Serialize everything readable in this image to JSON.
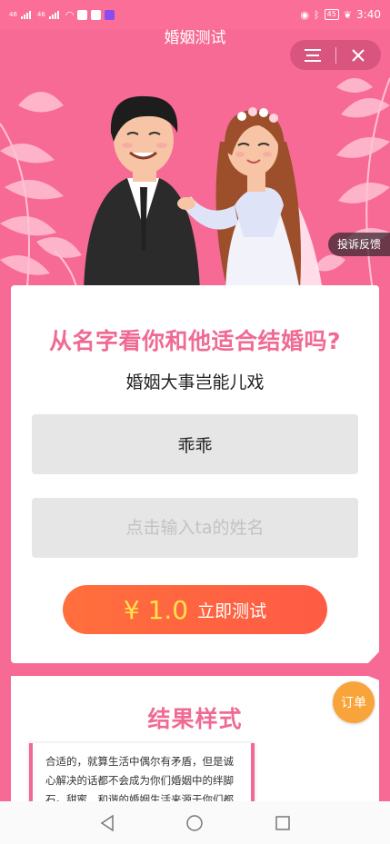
{
  "status_bar": {
    "signal1": "46",
    "signal2": "46",
    "battery": "45",
    "time": "3:40"
  },
  "header": {
    "title": "婚姻测试",
    "menu_icon": "menu-icon",
    "close_icon": "close-icon"
  },
  "hero": {
    "complaint_label": "投诉反馈"
  },
  "card": {
    "title": "从名字看你和他适合结婚吗?",
    "subtitle": "婚姻大事岂能儿戏",
    "name_value": "乖乖",
    "partner_placeholder": "点击输入ta的姓名",
    "price": "¥ 1.0",
    "button_label": "立即测试"
  },
  "result": {
    "title": "结果样式",
    "sample_text": "合适的，就算生活中偶尔有矛盾，但是诚心解决的话都不会成为你们婚姻中的绊脚石。甜蜜、和谐的婚姻生活来源于你们都爱着对方，"
  },
  "order_badge": "订单",
  "colors": {
    "background": "#f76a95",
    "accent_pink": "#f06a93",
    "button_orange": "#ff6141",
    "price_yellow": "#ffe14d",
    "order_orange": "#f9a43a"
  },
  "nav": {
    "back_icon": "back-icon",
    "home_icon": "home-icon",
    "recents_icon": "recents-icon"
  }
}
